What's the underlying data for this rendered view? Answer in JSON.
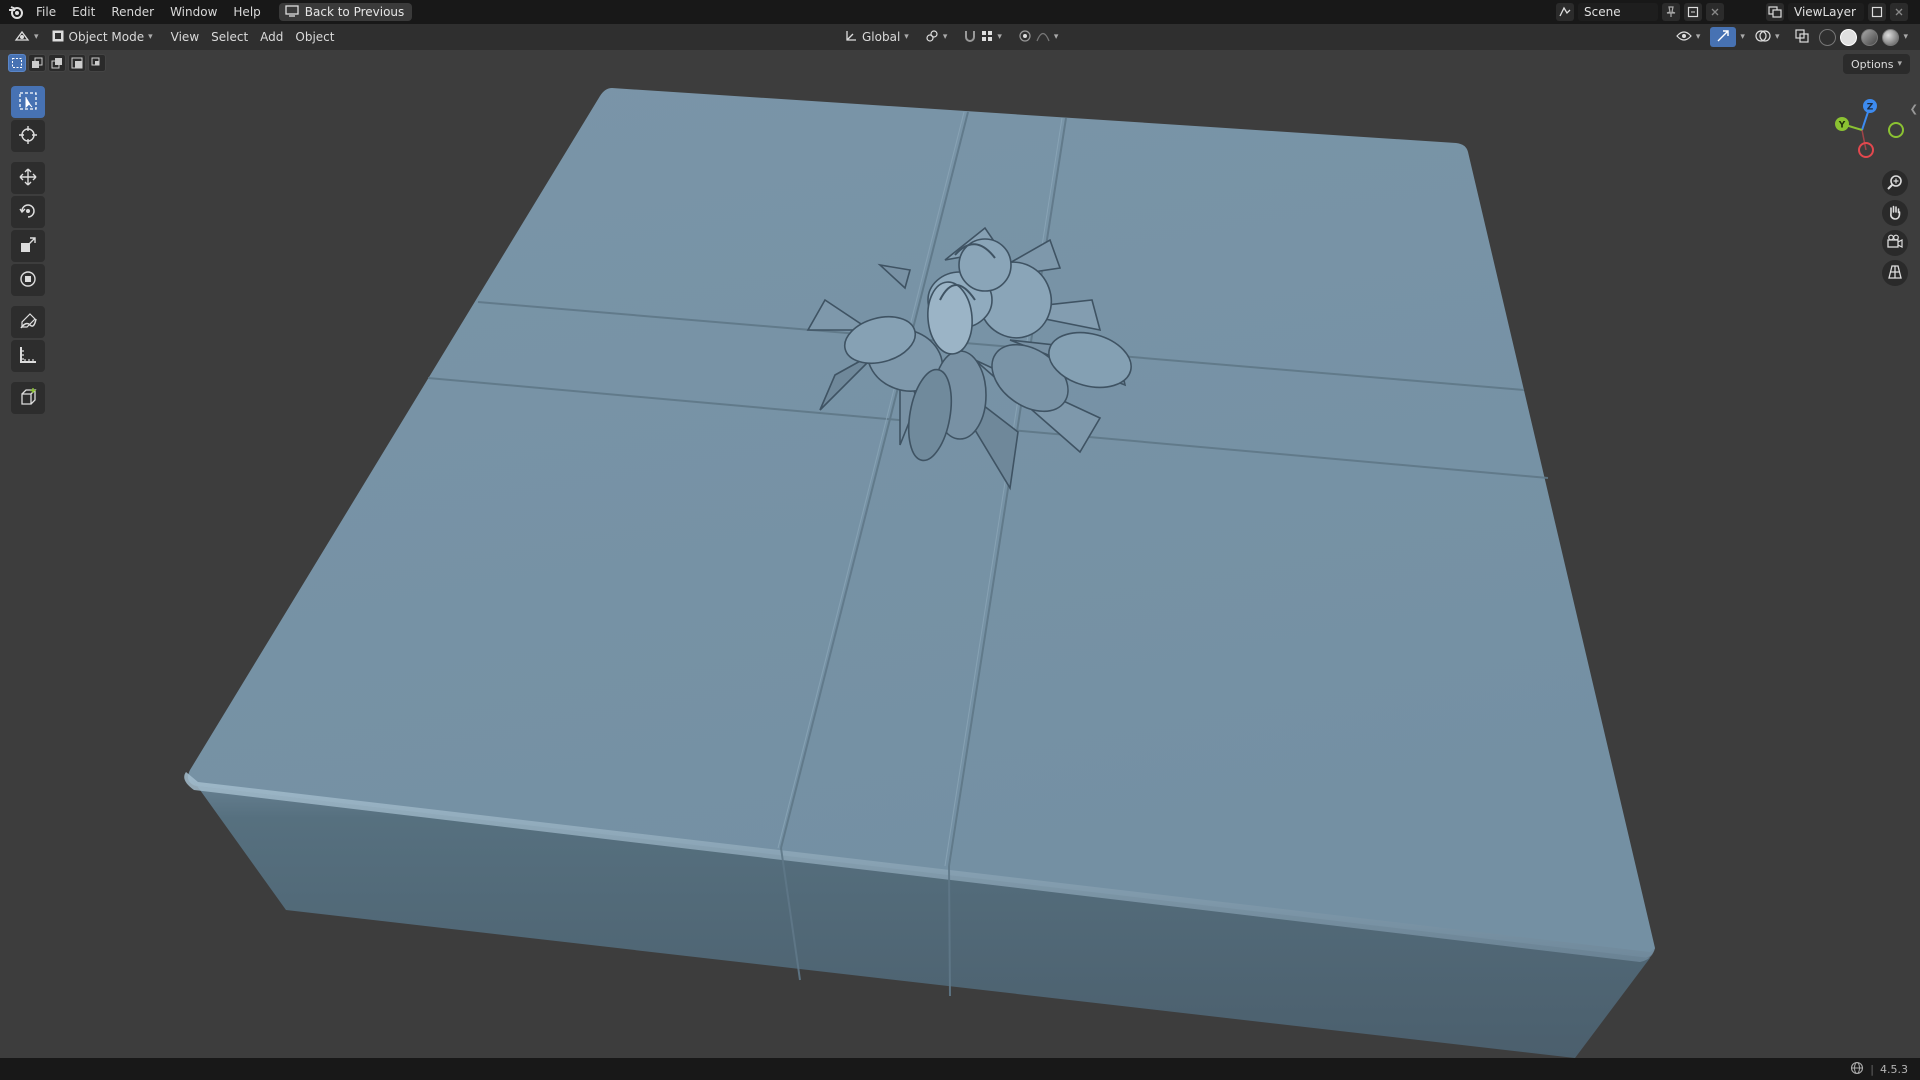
{
  "topbar": {
    "menu": [
      "File",
      "Edit",
      "Render",
      "Window",
      "Help"
    ],
    "back_button": "Back to Previous",
    "scene_name": "Scene",
    "view_layer_name": "ViewLayer"
  },
  "viewport_header": {
    "mode": "Object Mode",
    "menus": [
      "View",
      "Select",
      "Add",
      "Object"
    ],
    "transform_orientation": "Global"
  },
  "options_label": "Options",
  "toolbar": {
    "tools": [
      "select-box",
      "cursor",
      "move",
      "rotate",
      "scale",
      "transform",
      "annotate",
      "measure",
      "add-cube"
    ],
    "active_tool": "select-box"
  },
  "gizmo": {
    "axes": {
      "x": "X",
      "y": "Y",
      "z": "Z"
    },
    "colors": {
      "x": "#e2484e",
      "y": "#8bc232",
      "z": "#3d8bf0"
    }
  },
  "statusbar": {
    "version": "4.5.3"
  },
  "colors": {
    "viewport_bg": "#3d3d3d",
    "accent": "#4772b3",
    "object_top": "#7a93a5",
    "object_side": "#52697b"
  }
}
